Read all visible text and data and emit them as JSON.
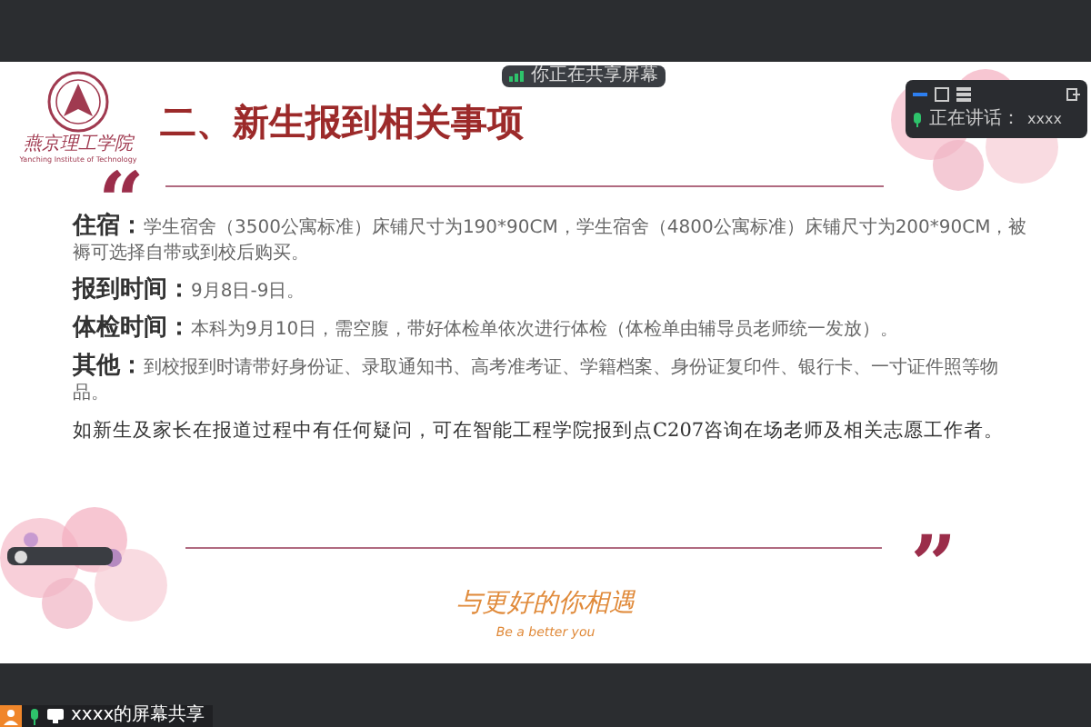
{
  "share_banner": {
    "text": "你正在共享屏幕"
  },
  "speaker_panel": {
    "speaking_label": "正在讲话：",
    "speaker": "xxxx"
  },
  "slide": {
    "logo": {
      "name": "燕京理工学院",
      "subtitle": "Yanching Institute of Technology"
    },
    "title": "二、新生报到相关事项",
    "open_quote": "“",
    "items": [
      {
        "label": "住宿：",
        "text": "学生宿舍（3500公寓标准）床铺尺寸为190*90CM，学生宿舍（4800公寓标准）床铺尺寸为200*90CM，被褥可选择自带或到校后购买。"
      },
      {
        "label": "报到时间：",
        "text": "9月8日-9日。"
      },
      {
        "label": "体检时间：",
        "text": "本科为9月10日，需空腹，带好体检单依次进行体检（体检单由辅导员老师统一发放）。"
      },
      {
        "label": "其他：",
        "text": "到校报到时请带好身份证、录取通知书、高考准考证、学籍档案、身份证复印件、银行卡、一寸证件照等物品。"
      }
    ],
    "note": "如新生及家长在报道过程中有任何疑问，可在智能工程学院报到点C207咨询在场老师及相关志愿工作者。",
    "close_quote": "”",
    "slogan": "与更好的你相遇",
    "slogan_en": "Be a better you"
  },
  "bottom_bar": {
    "share_label": "xxxx的屏幕共享"
  }
}
